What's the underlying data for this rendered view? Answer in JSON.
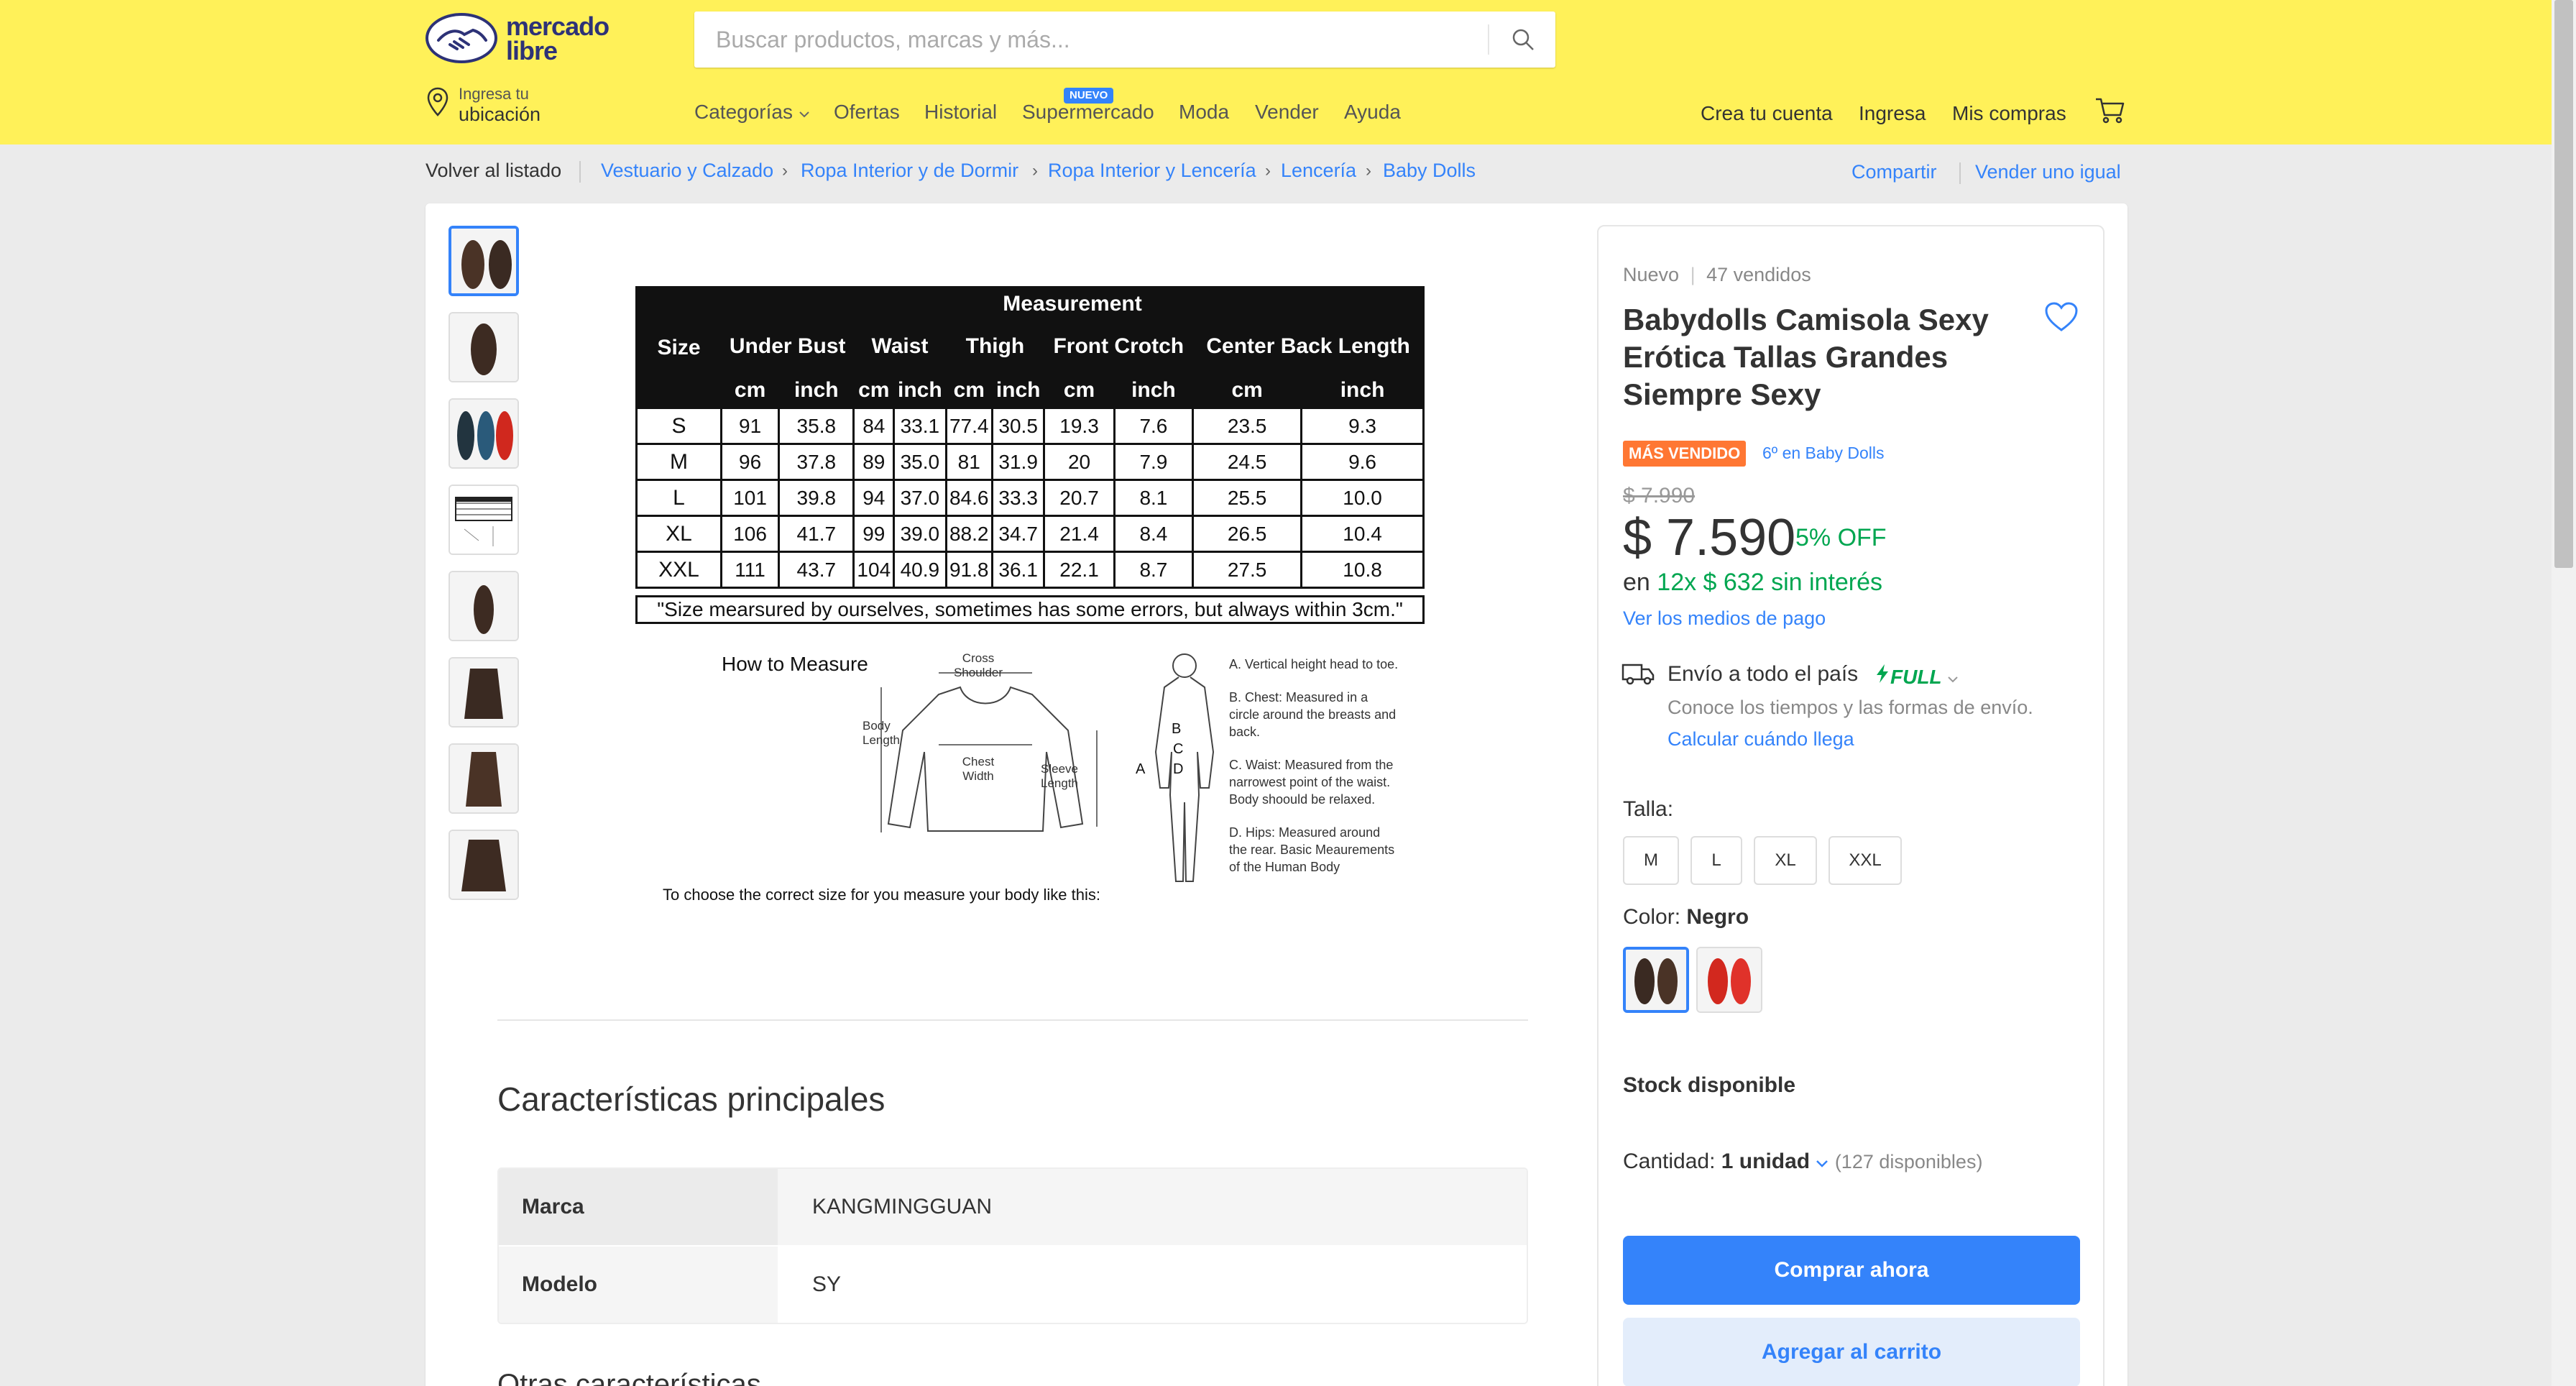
{
  "header": {
    "logo_line1": "mercado",
    "logo_line2": "libre",
    "search_placeholder": "Buscar productos, marcas y más...",
    "location_small": "Ingresa tu",
    "location_big": "ubicación",
    "nav": [
      "Categorías",
      "Ofertas",
      "Historial",
      "Supermercado",
      "Moda",
      "Vender",
      "Ayuda"
    ],
    "nuevo_badge": "NUEVO",
    "crea_cuenta": "Crea tu cuenta",
    "ingresa": "Ingresa",
    "mis_compras": "Mis compras"
  },
  "breadcrumb": {
    "back": "Volver al listado",
    "items": [
      "Vestuario y Calzado",
      "Ropa Interior y de Dormir",
      "Ropa Interior y Lencería",
      "Lencería",
      "Baby Dolls"
    ],
    "share": "Compartir",
    "sell_same": "Vender uno igual"
  },
  "size_chart": {
    "header_measurement": "Measurement",
    "size_label": "Size",
    "columns": [
      "Under Bust",
      "Waist",
      "Thigh",
      "Front Crotch",
      "Center Back Length"
    ],
    "unit_cm": "cm",
    "unit_inch": "inch",
    "rows": [
      [
        "S",
        "91",
        "35.8",
        "84",
        "33.1",
        "77.4",
        "30.5",
        "19.3",
        "7.6",
        "23.5",
        "9.3"
      ],
      [
        "M",
        "96",
        "37.8",
        "89",
        "35.0",
        "81",
        "31.9",
        "20",
        "7.9",
        "24.5",
        "9.6"
      ],
      [
        "L",
        "101",
        "39.8",
        "94",
        "37.0",
        "84.6",
        "33.3",
        "20.7",
        "8.1",
        "25.5",
        "10.0"
      ],
      [
        "XL",
        "106",
        "41.7",
        "99",
        "39.0",
        "88.2",
        "34.7",
        "21.4",
        "8.4",
        "26.5",
        "10.4"
      ],
      [
        "XXL",
        "111",
        "43.7",
        "104",
        "40.9",
        "91.8",
        "36.1",
        "22.1",
        "8.7",
        "27.5",
        "10.8"
      ]
    ],
    "note": "\"Size mearsured by ourselves, sometimes has some errors, but always within 3cm.\"",
    "how_to": "How to Measure",
    "choose": "To choose the correct size for you measure your body like this:",
    "label_cross_shoulder": "Cross Shoulder",
    "label_body_length": "Body Length",
    "label_chest_width": "Chest Width",
    "label_sleeve_length": "Sleeve Length",
    "note_a": "A. Vertical height head to toe.",
    "note_b": "B. Chest: Measured in a circle around the breasts and back.",
    "note_c": "C. Waist: Measured from the narrowest point of the waist. Body shoould be relaxed.",
    "note_d": "D. Hips: Measured around the rear. Basic Meaurements of the Human Body"
  },
  "features": {
    "title": "Características principales",
    "rows": [
      {
        "key": "Marca",
        "value": "KANGMINGGUAN"
      },
      {
        "key": "Modelo",
        "value": "SY"
      }
    ],
    "other_title": "Otras características"
  },
  "buy_box": {
    "condition": "Nuevo",
    "sold": "47 vendidos",
    "title": "Babydolls Camisola Sexy Erótica Tallas Grandes Siempre Sexy",
    "badge": "MÁS VENDIDO",
    "rank": "6º en Baby Dolls",
    "old_price": "$ 7.990",
    "price": "$ 7.590",
    "discount": "5% OFF",
    "installments_prefix": "en",
    "installments": "12x $ 632 sin interés",
    "payment_link": "Ver los medios de pago",
    "shipping": "Envío a todo el país",
    "full": "FULL",
    "shipping_sub": "Conoce los tiempos y las formas de envío.",
    "shipping_link": "Calcular cuándo llega",
    "size_label": "Talla:",
    "sizes": [
      "M",
      "L",
      "XL",
      "XXL"
    ],
    "color_label": "Color:",
    "color_value": "Negro",
    "stock": "Stock disponible",
    "qty_label": "Cantidad:",
    "qty_value": "1 unidad",
    "qty_available": "(127 disponibles)",
    "buy_now": "Comprar ahora",
    "add_cart": "Agregar al carrito"
  },
  "colors": {
    "brand_yellow": "#fff159",
    "accent_blue": "#3483fa",
    "green": "#00a650",
    "badge_orange": "#ff7733"
  }
}
